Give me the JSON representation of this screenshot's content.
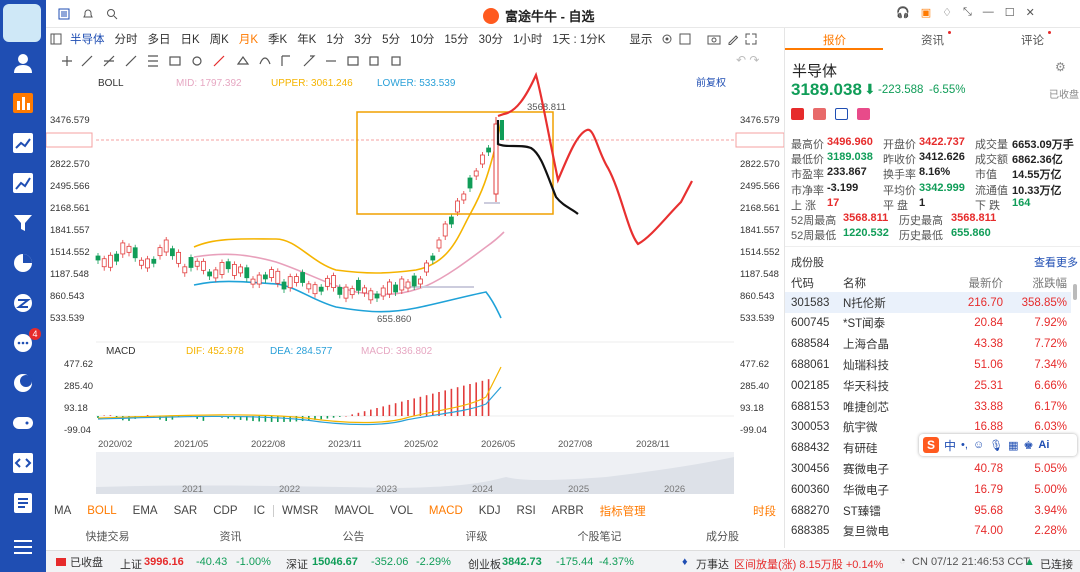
{
  "app": {
    "title": "富途牛牛 - 自选"
  },
  "sidebar": {
    "badge": "4"
  },
  "timeframes": [
    "半导体",
    "分时",
    "多日",
    "日K",
    "周K",
    "月K",
    "季K",
    "年K",
    "1分",
    "3分",
    "5分",
    "10分",
    "15分",
    "30分",
    "1小时",
    "1天 : 1分K",
    "显示"
  ],
  "timeframe_active": "月K",
  "toolbar": {
    "boll_label": "BOLL",
    "mid": "MID: 1797.392",
    "upper": "UPPER: 3061.246",
    "lower": "LOWER: 533.539",
    "adjust": "前复权"
  },
  "price_axis": [
    "3476.579",
    "3189.038",
    "2822.570",
    "2495.566",
    "2168.561",
    "1841.557",
    "1514.552",
    "1187.548",
    "860.543",
    "533.539"
  ],
  "price_axis_right": [
    "3476.579",
    "3189.038",
    "2822.570",
    "2495.566",
    "2168.561",
    "1841.557",
    "1514.552",
    "1187.548",
    "860.543",
    "533.539"
  ],
  "annotations": {
    "high": "3568.811",
    "low": "655.860"
  },
  "macd": {
    "label": "MACD",
    "dif": "DIF: 452.978",
    "dea": "DEA: 284.577",
    "macd": "MACD: 336.802",
    "axis": [
      "477.62",
      "285.40",
      "93.18",
      "-99.04"
    ]
  },
  "x_axis": [
    "2020/02",
    "2021/05",
    "2022/08",
    "2023/11",
    "2025/02",
    "2026/05",
    "2027/08",
    "2028/11"
  ],
  "mini_axis": [
    "2021",
    "2022",
    "2023",
    "2024",
    "2025",
    "2026"
  ],
  "indicators": [
    "MA",
    "BOLL",
    "EMA",
    "SAR",
    "CDP",
    "IC",
    "WMSR",
    "MAVOL",
    "VOL",
    "MACD",
    "KDJ",
    "RSI",
    "ARBR",
    "指标管理",
    "时段"
  ],
  "indicator_active": [
    "BOLL",
    "MACD"
  ],
  "subtabs": [
    "快捷交易",
    "资讯",
    "公告",
    "评级",
    "个股笔记",
    "成分股"
  ],
  "right": {
    "tabs": [
      "报价",
      "资讯",
      "评论"
    ],
    "name": "半导体",
    "price": "3189.038",
    "change": "-223.588",
    "pct": "-6.55%",
    "status": "已收盘",
    "stats": [
      [
        "最高价",
        "3496.960",
        "开盘价",
        "3422.737",
        "成交量",
        "6653.09万手"
      ],
      [
        "最低价",
        "3189.038",
        "昨收价",
        "3412.626",
        "成交额",
        "6862.36亿"
      ],
      [
        "市盈率",
        "233.867",
        "换手率",
        "8.16%",
        "市值",
        "14.55万亿"
      ],
      [
        "市净率",
        "-3.199",
        "平均价",
        "3342.999",
        "流通值",
        "10.33万亿"
      ],
      [
        "上  涨",
        "17",
        "平  盘",
        "1",
        "下  跌",
        "164"
      ],
      [
        "52周最高",
        "3568.811",
        "历史最高",
        "3568.811",
        "",
        ""
      ],
      [
        "52周最低",
        "1220.532",
        "历史最低",
        "655.860",
        "",
        ""
      ]
    ],
    "components_title": "成份股",
    "see_more": "查看更多",
    "columns": [
      "代码",
      "名称",
      "最新价",
      "涨跌幅"
    ],
    "rows": [
      [
        "301583",
        "N托伦斯",
        "216.70",
        "358.85%"
      ],
      [
        "600745",
        "*ST闻泰",
        "20.84",
        "7.92%"
      ],
      [
        "688584",
        "上海合晶",
        "43.38",
        "7.72%"
      ],
      [
        "688061",
        "灿瑞科技",
        "51.06",
        "7.34%"
      ],
      [
        "002185",
        "华天科技",
        "25.31",
        "6.66%"
      ],
      [
        "688153",
        "唯捷创芯",
        "33.88",
        "6.17%"
      ],
      [
        "300053",
        "航宇微",
        "16.88",
        "6.03%"
      ],
      [
        "688432",
        "有研硅",
        "",
        ""
      ],
      [
        "300456",
        "赛微电子",
        "40.78",
        "5.05%"
      ],
      [
        "600360",
        "华微电子",
        "16.79",
        "5.00%"
      ],
      [
        "688270",
        "ST臻镭",
        "95.68",
        "3.94%"
      ],
      [
        "688385",
        "复旦微电",
        "74.00",
        "2.28%"
      ]
    ]
  },
  "statusbar": {
    "closed": "已收盘",
    "sh_label": "上证",
    "sh_val": "3996.16",
    "sh_chg": "-40.43",
    "sh_pct": "-1.00%",
    "sz_label": "深证",
    "sz_val": "15046.67",
    "sz_chg": "-352.06",
    "sz_pct": "-2.29%",
    "cy_label": "创业板",
    "cy_val": "3842.73",
    "cy_chg": "-175.44",
    "cy_pct": "-4.37%",
    "right_text1": "万事达",
    "right_text2": "区间放量(涨) 8.15万股 +0.14%",
    "time": "CN 07/12 21:46:53 CCT",
    "conn": "已连接"
  }
}
